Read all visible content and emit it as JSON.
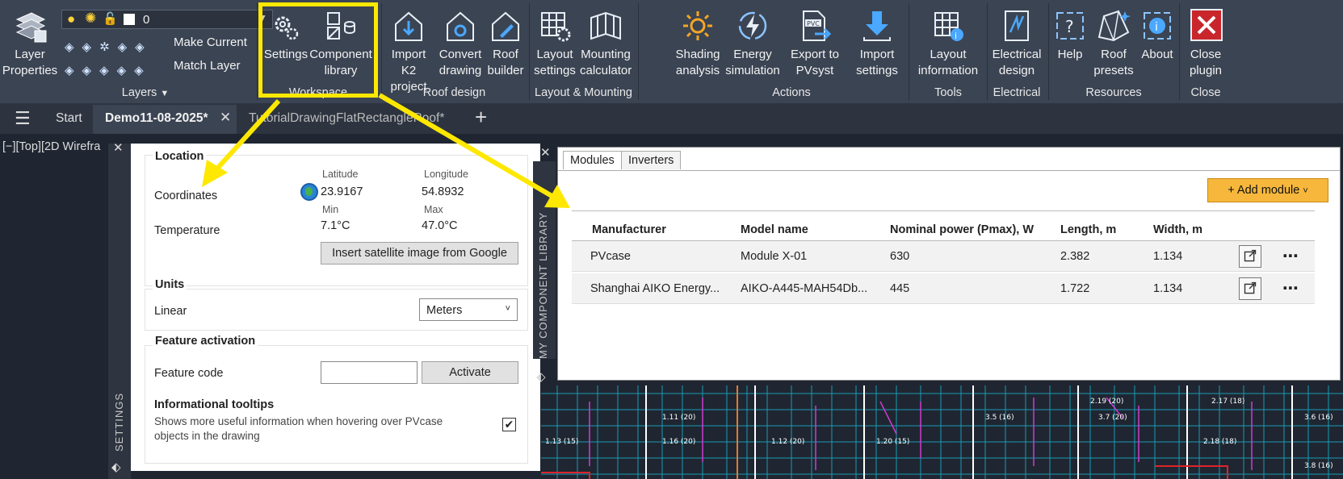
{
  "ribbon": {
    "layers": {
      "layer_properties": "Layer Properties",
      "layer_name": "0",
      "make_current": "Make Current",
      "match_layer": "Match Layer",
      "group": "Layers"
    },
    "workspace": {
      "settings": "Settings",
      "component_library": "Component library",
      "group": "Workspace"
    },
    "roof": {
      "import_k2": "Import K2 project",
      "convert": "Convert drawing",
      "roof_builder": "Roof builder",
      "group": "Roof design"
    },
    "layout": {
      "layout_settings": "Layout settings",
      "mounting_calc": "Mounting calculator",
      "group": "Layout & Mounting"
    },
    "actions": {
      "shading": "Shading analysis",
      "energy": "Energy simulation",
      "export": "Export to PVsyst",
      "import_settings": "Import settings",
      "group": "Actions"
    },
    "tools": {
      "layout_info": "Layout information",
      "group": "Tools"
    },
    "electrical": {
      "electrical_design": "Electrical design",
      "group": "Electrical"
    },
    "resources": {
      "help": "Help",
      "roof_presets": "Roof presets",
      "about": "About",
      "group": "Resources"
    },
    "close": {
      "close_plugin": "Close plugin",
      "group": "Close"
    }
  },
  "tabs": {
    "start": "Start",
    "active": "Demo11-08-2025*",
    "other": "TutorialDrawingFlatRectangleRoof*"
  },
  "viewport_label": "[−][Top][2D Wirefra",
  "settings": {
    "strip_title": "SETTINGS",
    "location": {
      "title": "Location",
      "coords_label": "Coordinates",
      "lat_label": "Latitude",
      "lat": "23.9167",
      "lon_label": "Longitude",
      "lon": "54.8932",
      "temp_label": "Temperature",
      "min_label": "Min",
      "min": "7.1°C",
      "max_label": "Max",
      "max": "47.0°C",
      "satellite_button": "Insert satellite image from Google"
    },
    "units": {
      "title": "Units",
      "linear_label": "Linear",
      "linear_value": "Meters"
    },
    "feature": {
      "title": "Feature activation",
      "code_label": "Feature code",
      "code_value": "",
      "activate": "Activate",
      "tooltips_title": "Informational tooltips",
      "tooltips_desc": "Shows more useful information when hovering over PVcase objects in the drawing",
      "tooltips_checked": true
    }
  },
  "library": {
    "strip_title": "MY COMPONENT LIBRARY",
    "tabs": [
      "Modules",
      "Inverters"
    ],
    "add_button": "+ Add module",
    "columns": [
      "Manufacturer",
      "Model name",
      "Nominal power (Pmax), W",
      "Length, m",
      "Width, m"
    ],
    "rows": [
      {
        "manufacturer": "PVcase",
        "model": "Module X-01",
        "power": "630",
        "length": "2.382",
        "width": "1.134"
      },
      {
        "manufacturer": "Shanghai AIKO Energy...",
        "model": "AIKO-A445-MAH54Db...",
        "power": "445",
        "length": "1.722",
        "width": "1.134"
      }
    ]
  },
  "cad_labels": [
    "1.11 (20)",
    "1.13 (15)",
    "1.16 (20)",
    "1.12 (20)",
    "1.20 (15)",
    "3.5 (16)",
    "3.7 (20)",
    "2.19 (20)",
    "2.17 (18)",
    "2.18 (18)",
    "3.6 (16)",
    "3.8 (16)"
  ],
  "colors": {
    "highlight": "#ffe800",
    "accent_button": "#f6b73c",
    "ribbon_bg": "#3b4453"
  }
}
